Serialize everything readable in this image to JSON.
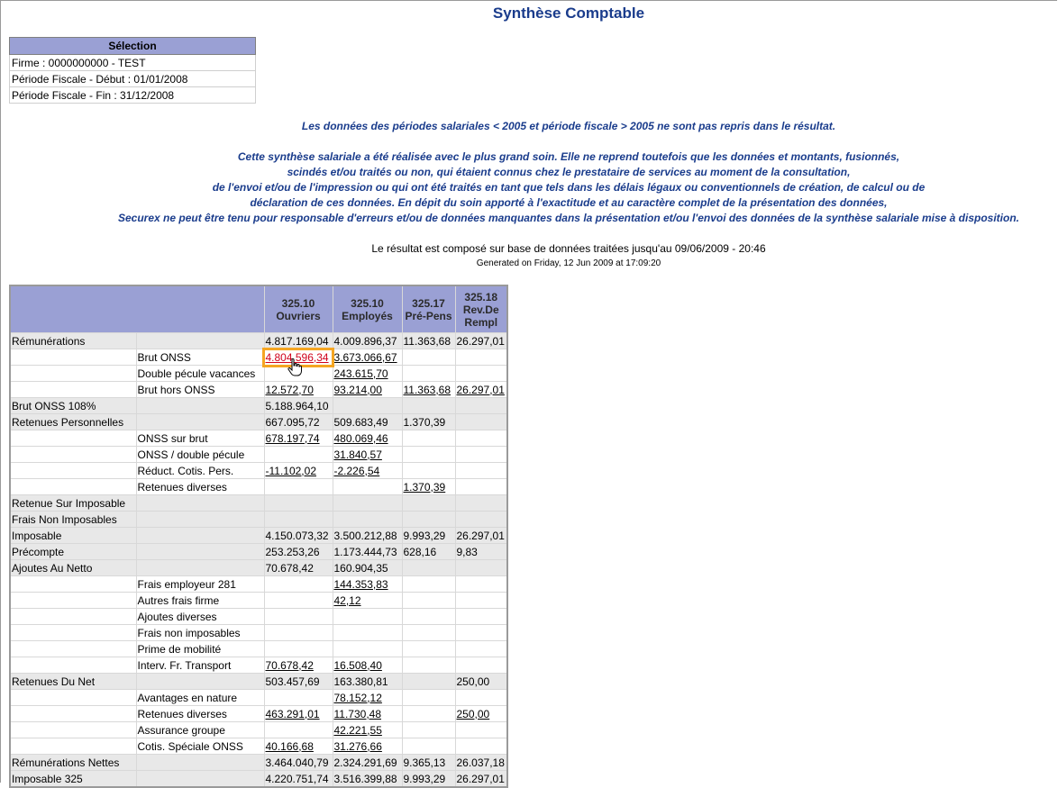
{
  "page": {
    "title": "Synthèse Comptable"
  },
  "selection": {
    "header": "Sélection",
    "rows": [
      "Firme : 0000000000 - TEST",
      "Période Fiscale - Début : 01/01/2008",
      "Période Fiscale - Fin : 31/12/2008"
    ]
  },
  "notices": {
    "periods": "Les données des périodes salariales < 2005 et période fiscale > 2005 ne sont pas repris dans le résultat.",
    "disclaimer": [
      "Cette synthèse salariale a été réalisée avec le plus grand soin. Elle ne reprend toutefois que les données et montants, fusionnés,",
      "scindés et/ou traités ou non, qui étaient connus chez le prestataire de services au moment de la consultation,",
      "de l'envoi et/ou de l'impression ou qui ont été traités en tant que tels dans les délais légaux ou conventionnels de création, de calcul ou de",
      "déclaration de ces données. En dépit du soin apporté à l'exactitude et au caractère complet de la présentation des données,",
      "Securex ne peut être tenu pour responsable d'erreurs et/ou de données manquantes dans la présentation et/ou l'envoi des données de la synthèse salariale mise à disposition."
    ],
    "result": "Le résultat est composé sur base de données traitées jusqu'au 09/06/2009 - 20:46",
    "generated": "Generated on Friday, 12 Jun 2009 at 17:09:20"
  },
  "synthesis": {
    "columns": [
      {
        "code": "325.10",
        "label": "Ouvriers"
      },
      {
        "code": "325.10",
        "label": "Employés"
      },
      {
        "code": "325.17",
        "label": "Pré-Pens"
      },
      {
        "code": "325.18",
        "label": "Rev.De Rempl"
      }
    ],
    "rows": [
      {
        "type": "main",
        "label": "Rémunérations",
        "sub": "",
        "values": [
          "4.817.169,04",
          "4.009.896,37",
          "11.363,68",
          "26.297,01"
        ],
        "links": [
          false,
          false,
          false,
          false
        ]
      },
      {
        "type": "sub",
        "label": "",
        "sub": "Brut ONSS",
        "values": [
          "4.804.596,34",
          "3.673.066,67",
          "",
          ""
        ],
        "links": [
          true,
          true,
          false,
          false
        ],
        "highlight": 0
      },
      {
        "type": "sub",
        "label": "",
        "sub": "Double pécule vacances",
        "values": [
          "",
          "243.615,70",
          "",
          ""
        ],
        "links": [
          false,
          true,
          false,
          false
        ]
      },
      {
        "type": "sub",
        "label": "",
        "sub": "Brut hors ONSS",
        "values": [
          "12.572,70",
          "93.214,00",
          "11.363,68",
          "26.297,01"
        ],
        "links": [
          true,
          true,
          true,
          true
        ]
      },
      {
        "type": "main",
        "label": "Brut ONSS 108%",
        "sub": "",
        "values": [
          "5.188.964,10",
          "",
          "",
          ""
        ],
        "links": [
          false,
          false,
          false,
          false
        ]
      },
      {
        "type": "main",
        "label": "Retenues Personnelles",
        "sub": "",
        "values": [
          "667.095,72",
          "509.683,49",
          "1.370,39",
          ""
        ],
        "links": [
          false,
          false,
          false,
          false
        ]
      },
      {
        "type": "sub",
        "label": "",
        "sub": "ONSS sur brut",
        "values": [
          "678.197,74",
          "480.069,46",
          "",
          ""
        ],
        "links": [
          true,
          true,
          false,
          false
        ]
      },
      {
        "type": "sub",
        "label": "",
        "sub": "ONSS / double pécule",
        "values": [
          "",
          "31.840,57",
          "",
          ""
        ],
        "links": [
          false,
          true,
          false,
          false
        ]
      },
      {
        "type": "sub",
        "label": "",
        "sub": "Réduct. Cotis. Pers.",
        "values": [
          "-11.102,02",
          "-2.226,54",
          "",
          ""
        ],
        "links": [
          true,
          true,
          false,
          false
        ]
      },
      {
        "type": "sub",
        "label": "",
        "sub": "Retenues diverses",
        "values": [
          "",
          "",
          "1.370,39",
          ""
        ],
        "links": [
          false,
          false,
          true,
          false
        ]
      },
      {
        "type": "main",
        "label": "Retenue Sur Imposable",
        "sub": "",
        "values": [
          "",
          "",
          "",
          ""
        ],
        "links": [
          false,
          false,
          false,
          false
        ]
      },
      {
        "type": "main",
        "label": "Frais Non Imposables",
        "sub": "",
        "values": [
          "",
          "",
          "",
          ""
        ],
        "links": [
          false,
          false,
          false,
          false
        ]
      },
      {
        "type": "main",
        "label": "Imposable",
        "sub": "",
        "values": [
          "4.150.073,32",
          "3.500.212,88",
          "9.993,29",
          "26.297,01"
        ],
        "links": [
          false,
          false,
          false,
          false
        ]
      },
      {
        "type": "main",
        "label": "Précompte",
        "sub": "",
        "values": [
          "253.253,26",
          "1.173.444,73",
          "628,16",
          "9,83"
        ],
        "links": [
          false,
          false,
          false,
          false
        ]
      },
      {
        "type": "main",
        "label": "Ajoutes Au Netto",
        "sub": "",
        "values": [
          "70.678,42",
          "160.904,35",
          "",
          ""
        ],
        "links": [
          false,
          false,
          false,
          false
        ]
      },
      {
        "type": "sub",
        "label": "",
        "sub": "Frais employeur 281",
        "values": [
          "",
          "144.353,83",
          "",
          ""
        ],
        "links": [
          false,
          true,
          false,
          false
        ]
      },
      {
        "type": "sub",
        "label": "",
        "sub": "Autres frais firme",
        "values": [
          "",
          "42,12",
          "",
          ""
        ],
        "links": [
          false,
          true,
          false,
          false
        ]
      },
      {
        "type": "sub",
        "label": "",
        "sub": "Ajoutes diverses",
        "values": [
          "",
          "",
          "",
          ""
        ],
        "links": [
          false,
          false,
          false,
          false
        ]
      },
      {
        "type": "sub",
        "label": "",
        "sub": "Frais non imposables",
        "values": [
          "",
          "",
          "",
          ""
        ],
        "links": [
          false,
          false,
          false,
          false
        ]
      },
      {
        "type": "sub",
        "label": "",
        "sub": "Prime de mobilité",
        "values": [
          "",
          "",
          "",
          ""
        ],
        "links": [
          false,
          false,
          false,
          false
        ]
      },
      {
        "type": "sub",
        "label": "",
        "sub": "Interv. Fr. Transport",
        "values": [
          "70.678,42",
          "16.508,40",
          "",
          ""
        ],
        "links": [
          true,
          true,
          false,
          false
        ]
      },
      {
        "type": "main",
        "label": "Retenues Du Net",
        "sub": "",
        "values": [
          "503.457,69",
          "163.380,81",
          "",
          "250,00"
        ],
        "links": [
          false,
          false,
          false,
          false
        ]
      },
      {
        "type": "sub",
        "label": "",
        "sub": "Avantages en nature",
        "values": [
          "",
          "78.152,12",
          "",
          ""
        ],
        "links": [
          false,
          true,
          false,
          false
        ]
      },
      {
        "type": "sub",
        "label": "",
        "sub": "Retenues diverses",
        "values": [
          "463.291,01",
          "11.730,48",
          "",
          "250,00"
        ],
        "links": [
          true,
          true,
          false,
          true
        ]
      },
      {
        "type": "sub",
        "label": "",
        "sub": "Assurance groupe",
        "values": [
          "",
          "42.221,55",
          "",
          ""
        ],
        "links": [
          false,
          true,
          false,
          false
        ]
      },
      {
        "type": "sub",
        "label": "",
        "sub": "Cotis. Spéciale ONSS",
        "values": [
          "40.166,68",
          "31.276,66",
          "",
          ""
        ],
        "links": [
          true,
          true,
          false,
          false
        ]
      },
      {
        "type": "main",
        "label": "Rémunérations Nettes",
        "sub": "",
        "values": [
          "3.464.040,79",
          "2.324.291,69",
          "9.365,13",
          "26.037,18"
        ],
        "links": [
          false,
          false,
          false,
          false
        ]
      },
      {
        "type": "main",
        "label": "Imposable 325",
        "sub": "",
        "values": [
          "4.220.751,74",
          "3.516.399,88",
          "9.993,29",
          "26.297,01"
        ],
        "links": [
          false,
          false,
          false,
          false
        ]
      }
    ]
  },
  "colors": {
    "header_bg": "#9aa0d4",
    "title": "#1a3c8c",
    "highlight_border": "#f5a623",
    "highlight_text": "#d0021b"
  }
}
